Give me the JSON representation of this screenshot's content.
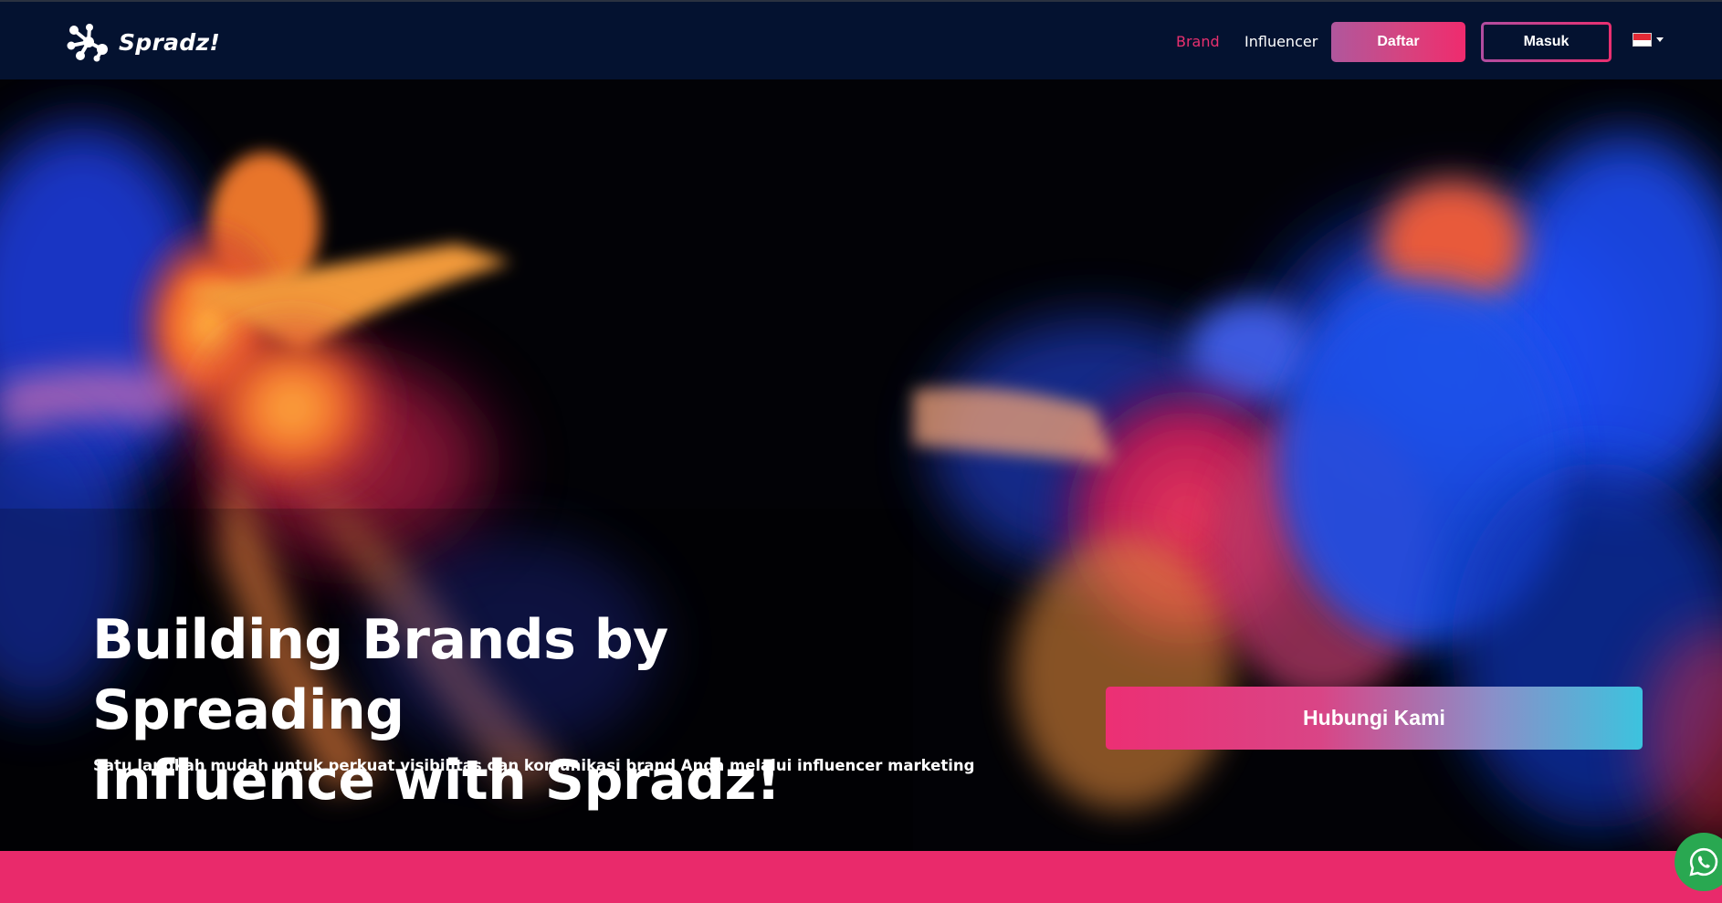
{
  "navbar": {
    "logo_text": "Spradz!",
    "links": [
      {
        "label": "Brand",
        "active": true
      },
      {
        "label": "Influencer",
        "active": false
      }
    ],
    "register_label": "Daftar",
    "login_label": "Masuk",
    "language_icon": "indonesia-flag-icon"
  },
  "hero": {
    "title_line1": "Building Brands by Spreading",
    "title_line2": "Influence with Spradz!",
    "subtitle": "Satu langkah mudah untuk perkuat visibilitas dan komunikasi brand Anda melalui influencer marketing",
    "cta_label": "Hubungi Kami"
  },
  "floating": {
    "whatsapp_icon": "whatsapp-icon"
  },
  "colors": {
    "nav_bg": "#041230",
    "accent_pink": "#e92a6b",
    "accent_cyan": "#3cc3de",
    "whatsapp_green": "#29a851"
  }
}
